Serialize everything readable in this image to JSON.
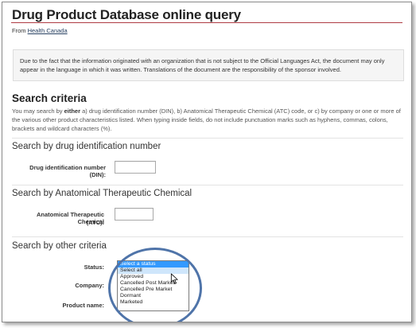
{
  "page": {
    "title": "Drug Product Database online query",
    "from_prefix": "From ",
    "from_link": "Health Canada"
  },
  "notice": "Due to the fact that the information originated with an organization that is not subject to the Official Languages Act, the document may only appear in the language in which it was written. Translations of the document are the responsibility of the sponsor involved.",
  "search_criteria": {
    "heading": "Search criteria",
    "intro_1": "You may search by ",
    "intro_bold": "either",
    "intro_2": " a) drug identification number (DIN), b) Anatomical Therapeutic Chemical (ATC) code, or c) by company or one or more of the various other product characteristics listed. When typing inside fields, do not include punctuation marks such as hyphens, commas, colons, brackets and wildcard characters (%)."
  },
  "din_section": {
    "heading": "Search by drug identification number",
    "label": "Drug identification number (DIN):",
    "value": ""
  },
  "atc_section": {
    "heading": "Search by Anatomical Therapeutic Chemical",
    "label_line1": "Anatomical Therapeutic Chemical",
    "label_line2": "(ATC):",
    "value": ""
  },
  "other_section": {
    "heading": "Search by other criteria",
    "status_label": "Status:",
    "company_label": "Company:",
    "product_label": "Product name:",
    "status_options": [
      "Select a status",
      "Select all",
      "Approved",
      "Cancelled Post Market",
      "Cancelled Pre Market",
      "Dormant",
      "Marketed"
    ],
    "selected_index": 0,
    "hovered_index": 1
  },
  "colors": {
    "title_rule": "#af3c43",
    "link": "#284162",
    "selected_option": "#3399ff",
    "highlight_circle": "#4f74a9"
  },
  "icons": [
    "mouse-pointer-icon"
  ]
}
